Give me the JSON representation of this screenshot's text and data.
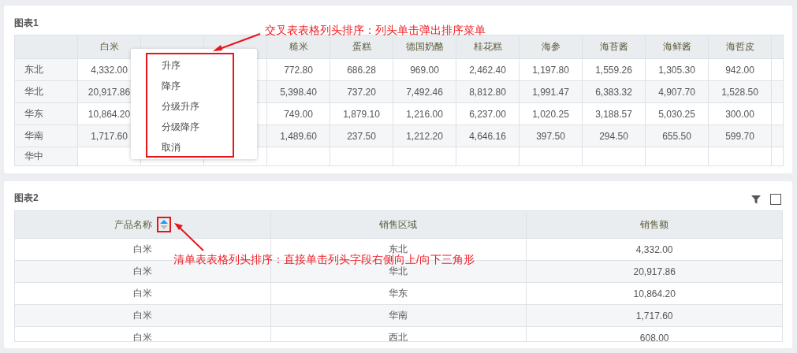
{
  "chart1": {
    "title": "图表1",
    "row_headers": [
      "东北",
      "华北",
      "华东",
      "华南",
      "华中"
    ],
    "columns_left": [
      {
        "header": "白米",
        "cells": [
          "4,332.00",
          "20,917.86",
          "10,864.20",
          "1,717.60"
        ]
      }
    ],
    "columns_right": [
      {
        "header": "糙米",
        "cells": [
          "772.80",
          "5,398.40",
          "749.00",
          "1,489.60"
        ]
      },
      {
        "header": "蛋糕",
        "cells": [
          "686.28",
          "737.20",
          "1,879.10",
          "237.50"
        ]
      },
      {
        "header": "德国奶酪",
        "cells": [
          "969.00",
          "7,492.46",
          "1,216.00",
          "1,212.20"
        ]
      },
      {
        "header": "桂花糕",
        "cells": [
          "2,462.40",
          "8,812.80",
          "6,237.00",
          "4,646.16"
        ]
      },
      {
        "header": "海参",
        "cells": [
          "1,197.80",
          "1,991.47",
          "1,020.25",
          "397.50"
        ]
      },
      {
        "header": "海苔酱",
        "cells": [
          "1,559.26",
          "6,383.32",
          "3,188.57",
          "294.50"
        ]
      },
      {
        "header": "海鲜酱",
        "cells": [
          "1,305.30",
          "4,907.70",
          "5,030.25",
          "655.50"
        ]
      },
      {
        "header": "海哲皮",
        "cells": [
          "942.00",
          "1,528.50",
          "300.00",
          "599.70"
        ]
      }
    ],
    "context_menu": {
      "items": [
        "升序",
        "降序",
        "分级升序",
        "分级降序",
        "取消"
      ]
    },
    "annotation": "交叉表表格列头排序：列头单击弹出排序菜单"
  },
  "chart2": {
    "title": "图表2",
    "columns": [
      {
        "label": "产品名称",
        "sortable": true,
        "ascending": true
      },
      {
        "label": "销售区域",
        "sortable": false
      },
      {
        "label": "销售额",
        "sortable": false
      }
    ],
    "rows": [
      [
        "白米",
        "东北",
        "4,332.00"
      ],
      [
        "白米",
        "华北",
        "20,917.86"
      ],
      [
        "白米",
        "华东",
        "10,864.20"
      ],
      [
        "白米",
        "华南",
        "1,717.60"
      ],
      [
        "白米",
        "西北",
        "608.00"
      ]
    ],
    "annotation": "清单表表格列头排序：直接单击列头字段右侧向上/向下三角形"
  }
}
